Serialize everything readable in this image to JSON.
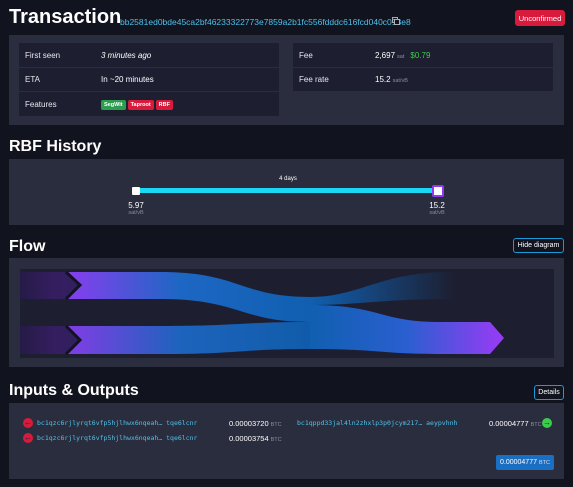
{
  "header": {
    "title": "Transaction",
    "txid": "bb2581ed0bde45ca2bf46233322773e7859a2b1fc556fdddc616fcd040c013e8",
    "status": "Unconfirmed"
  },
  "summary": {
    "first_seen_label": "First seen",
    "first_seen_value": "3 minutes ago",
    "eta_label": "ETA",
    "eta_value": "In ~20 minutes",
    "features_label": "Features",
    "features": [
      "SegWit",
      "Taproot",
      "RBF"
    ],
    "fee_label": "Fee",
    "fee_value": "2,697",
    "fee_unit": "sat",
    "fee_usd": "$0.79",
    "fee_rate_label": "Fee rate",
    "fee_rate_value": "15.2",
    "fee_rate_unit": "sat/vB"
  },
  "rbf": {
    "title": "RBF History",
    "duration": "4 days",
    "from_value": "5.97",
    "from_unit": "sat/vB",
    "to_value": "15.2",
    "to_unit": "sat/vB"
  },
  "flow": {
    "title": "Flow",
    "toggle_label": "Hide diagram"
  },
  "io": {
    "title": "Inputs & Outputs",
    "details_label": "Details",
    "inputs": [
      {
        "address": "bc1qzc6rjlyrqt6vfp5hjlhwx6nqeah… tqe6lcnr",
        "amount": "0.00003720",
        "unit": "BTC"
      },
      {
        "address": "bc1qzc6rjlyrqt6vfp5hjlhwx6nqeah… tqe6lcnr",
        "amount": "0.00003754",
        "unit": "BTC"
      }
    ],
    "outputs": [
      {
        "address": "bc1qppd33jal4ln2zhxlp3p0jcym217… aeypvhnh",
        "amount": "0.00004777",
        "unit": "BTC"
      }
    ],
    "total_amount": "0.00004777",
    "total_unit": "BTC"
  },
  "colors": {
    "background": "#11131f",
    "panel": "#2a2d3e",
    "cell": "#1d1f31",
    "accent_link": "#4fc1e9",
    "unconfirmed": "#d81b3c",
    "rbf_line": "#1bd8f4",
    "flow_start": "#9339f4",
    "flow_end": "#105fb0",
    "green": "#3bcc49"
  }
}
